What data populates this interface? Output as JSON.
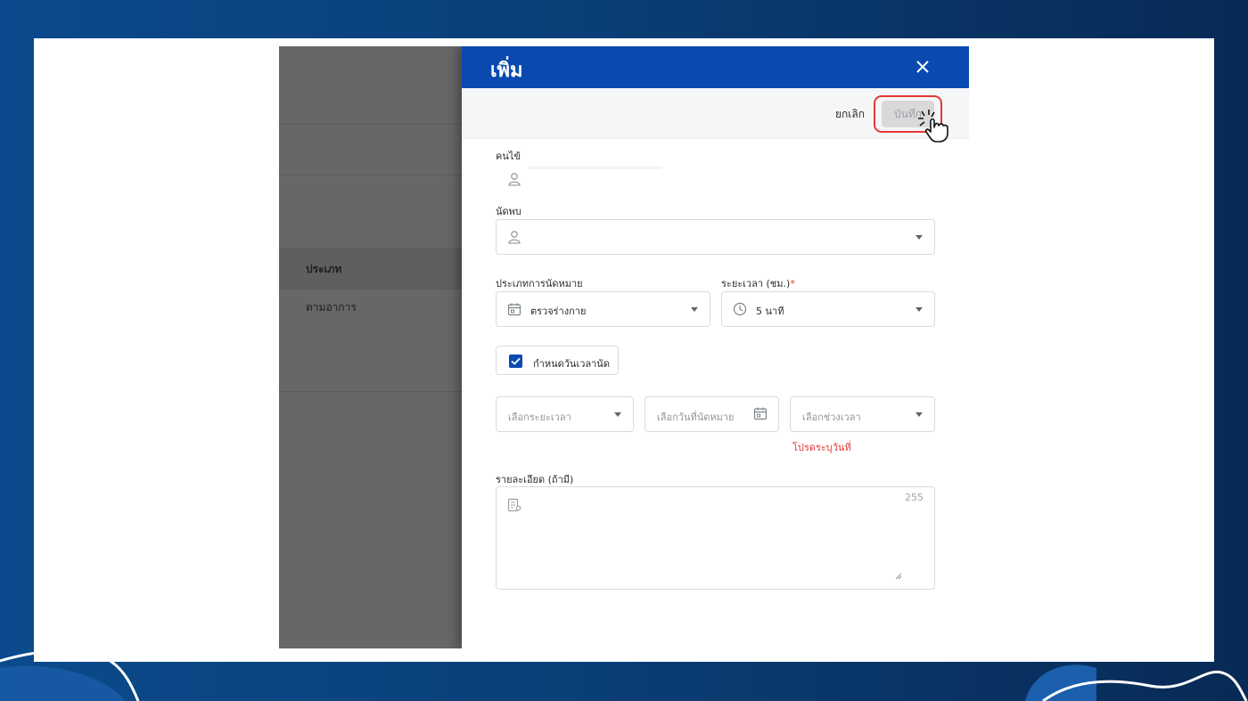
{
  "drawer": {
    "title": "เพิ่ม",
    "close_icon": "close-icon",
    "cancel_label": "ยกเลิก",
    "save_label": "บันทึก"
  },
  "background_panel": {
    "type_header": "ประเภท",
    "type_value": "ตามอาการ"
  },
  "form": {
    "patient_label": "คนไข้",
    "appointee_label": "นัดพบ",
    "appointment_type_label": "ประเภทการนัดหมาย",
    "appointment_type_value": "ตรวจร่างกาย",
    "duration_label": "ระยะเวลา (ชม.)",
    "duration_required": "*",
    "duration_value": "5 นาที",
    "set_datetime_label": "กำหนดวันเวลานัด",
    "set_datetime_checked": true,
    "period_placeholder": "เลือกระยะเวลา",
    "date_placeholder": "เลือกวันที่นัดหมาย",
    "timeslot_placeholder": "เลือกช่วงเวลา",
    "date_error": "โปรดระบุวันที่",
    "details_label": "รายละเอียด (ถ้ามี)",
    "details_counter": "255"
  },
  "icons": {
    "person": "person-icon",
    "calendar": "calendar-icon",
    "clock": "clock-icon",
    "notes": "notes-icon",
    "pointer": "hand-pointer-icon"
  },
  "colors": {
    "header_blue": "#0a4ab0",
    "error_red": "#e53935",
    "backdrop_gray": "#676767"
  }
}
